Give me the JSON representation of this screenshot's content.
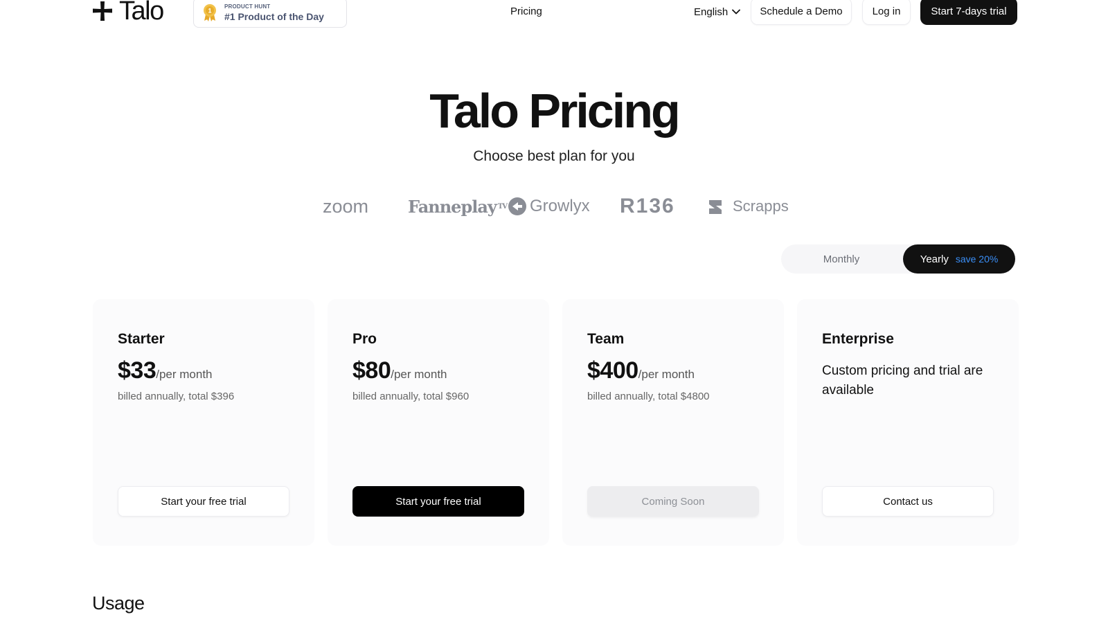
{
  "header": {
    "logo_text": "Talo",
    "badge": {
      "kicker": "PRODUCT HUNT",
      "title": "#1 Product of the Day"
    },
    "nav_pricing": "Pricing",
    "language": "English",
    "schedule_demo": "Schedule a Demo",
    "login": "Log in",
    "start_trial": "Start 7-days trial"
  },
  "hero": {
    "title": "Talo Pricing",
    "subtitle": "Choose best plan for you"
  },
  "brands": {
    "zoom": "zoom",
    "fanplay": "Fanneplay",
    "fanplay_tv": "TV",
    "growlyx": "Growlyx",
    "r136": "R136",
    "scrapps": "Scrapps"
  },
  "billing_toggle": {
    "monthly": "Monthly",
    "yearly": "Yearly",
    "save": "save 20%",
    "selected": "Yearly"
  },
  "plans": [
    {
      "name": "Starter",
      "price": "$33",
      "period": "/per month",
      "billed": "billed annually, total $396",
      "button": "Start your free trial"
    },
    {
      "name": "Pro",
      "price": "$80",
      "period": "/per month",
      "billed": "billed annually, total $960",
      "button": "Start your free trial"
    },
    {
      "name": "Team",
      "price": "$400",
      "period": "/per month",
      "billed": "billed annually, total $4800",
      "button": "Coming Soon"
    },
    {
      "name": "Enterprise",
      "description": "Custom pricing and trial are available",
      "button": "Contact us"
    }
  ],
  "usage_heading": "Usage",
  "colors": {
    "primary": "#111111",
    "accent_blue": "#3a8ef6",
    "card_bg": "#fbfbfc",
    "brand_gray": "#8a8d95"
  }
}
